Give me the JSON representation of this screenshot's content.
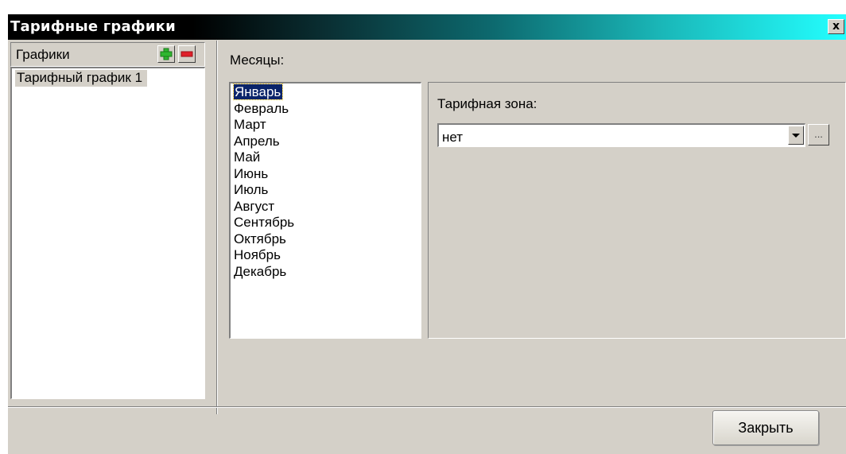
{
  "window": {
    "title": "Тарифные графики",
    "close_glyph": "x"
  },
  "graphs_panel": {
    "header_label": "Графики",
    "add_icon": "green-plus-icon",
    "remove_icon": "red-minus-icon",
    "items": [
      "Тарифный график 1"
    ]
  },
  "months_panel": {
    "label": "Месяцы:",
    "items": [
      "Январь",
      "Февраль",
      "Март",
      "Апрель",
      "Май",
      "Июнь",
      "Июль",
      "Август",
      "Сентябрь",
      "Октябрь",
      "Ноябрь",
      "Декабрь"
    ],
    "selected": "Январь"
  },
  "zone_panel": {
    "label": "Тарифная зона:",
    "value": "нет",
    "ellipsis_label": "..."
  },
  "footer": {
    "close_label": "Закрыть"
  },
  "colors": {
    "selection": "#0a246a",
    "add_icon": "#2fb62f",
    "remove_icon": "#e0202a"
  }
}
